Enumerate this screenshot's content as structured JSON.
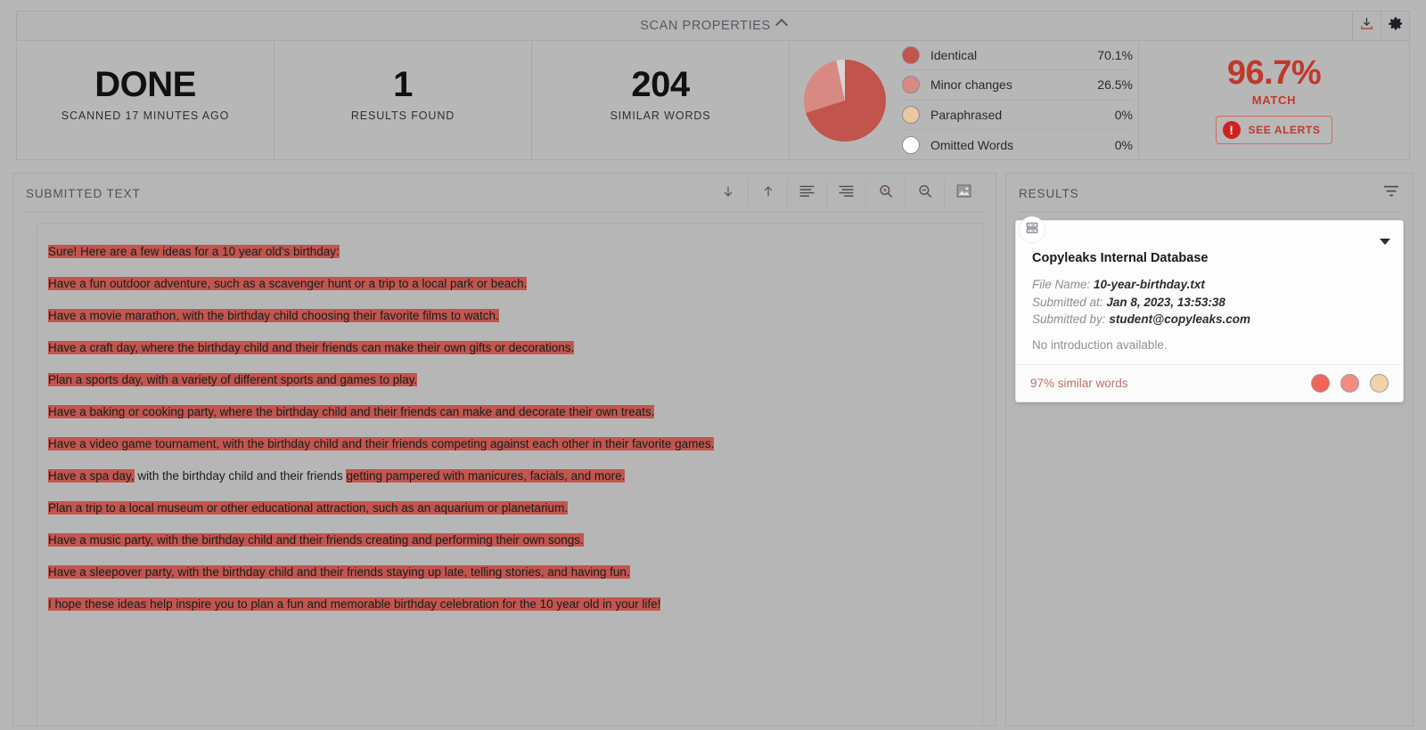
{
  "topbar": {
    "title": "SCAN PROPERTIES",
    "chevron_icon": "chevron-up-icon",
    "download_icon": "download-icon",
    "settings_icon": "gear-icon"
  },
  "stats": [
    {
      "value": "DONE",
      "label": "SCANNED 17 MINUTES AGO"
    },
    {
      "value": "1",
      "label": "RESULTS FOUND"
    },
    {
      "value": "204",
      "label": "SIMILAR WORDS"
    }
  ],
  "match": {
    "percent": "96.7%",
    "label": "MATCH",
    "alerts_button": "SEE ALERTS",
    "alert_icon": "!",
    "color": "#c0392b"
  },
  "chart_data": {
    "type": "pie",
    "title": "",
    "labels": [
      "Identical",
      "Minor changes",
      "Paraphrased",
      "Omitted Words"
    ],
    "values": [
      70.1,
      26.5,
      0,
      0
    ],
    "value_labels": [
      "70.1%",
      "26.5%",
      "0%",
      "0%"
    ],
    "colors": [
      "#c1544c",
      "#d98983",
      "#e7c8a0",
      "#ffffff"
    ],
    "legend_position": "right",
    "grid": false
  },
  "submitted_panel": {
    "title": "SUBMITTED TEXT",
    "tools": [
      {
        "name": "scroll-down-icon",
        "glyph": "↓"
      },
      {
        "name": "scroll-up-icon",
        "glyph": "↑"
      },
      {
        "name": "align-left-icon",
        "glyph": "align-left"
      },
      {
        "name": "align-right-icon",
        "glyph": "align-right"
      },
      {
        "name": "zoom-in-icon",
        "glyph": "zoom-in"
      },
      {
        "name": "zoom-out-icon",
        "glyph": "zoom-out"
      },
      {
        "name": "image-view-icon",
        "glyph": "image"
      }
    ],
    "lines": [
      [
        {
          "t": "Sure! Here are a few ideas for a 10 year old's birthday:",
          "h": true
        }
      ],
      [
        {
          "t": "Have a fun outdoor adventure, such as a scavenger hunt or a trip to a local park or beach.",
          "h": true
        }
      ],
      [
        {
          "t": "Have a movie marathon, with the birthday child choosing their favorite films to watch.",
          "h": true
        }
      ],
      [
        {
          "t": "Have a craft day, where the birthday child and their friends can make their own gifts or decorations.",
          "h": true
        }
      ],
      [
        {
          "t": "Plan a sports day, with a variety of different sports and games to play.",
          "h": true
        }
      ],
      [
        {
          "t": "Have a baking or cooking party, where the birthday child and their friends can make and decorate their own treats.",
          "h": true
        }
      ],
      [
        {
          "t": "Have a video game tournament, with the birthday child and their friends competing against each other in their favorite games.",
          "h": true
        }
      ],
      [
        {
          "t": "Have a spa day,",
          "h": true
        },
        {
          "t": " with the birthday child and their friends ",
          "h": false
        },
        {
          "t": "getting pampered with manicures, facials, and more.",
          "h": true
        }
      ],
      [
        {
          "t": "Plan a trip to a local museum or other educational attraction, such as an aquarium or planetarium.",
          "h": true
        }
      ],
      [
        {
          "t": "Have a music party, with the birthday child and their friends creating and performing their own songs.",
          "h": true
        }
      ],
      [
        {
          "t": "Have a sleepover party, with the birthday child and their friends staying up late, telling stories, and having fun.",
          "h": true
        }
      ],
      [
        {
          "t": "I hope these ideas help inspire you to plan a fun and memorable birthday celebration for the 10 year old in your life!",
          "h": true
        }
      ]
    ],
    "highlight_color": "#c2564f"
  },
  "results_panel": {
    "title": "RESULTS",
    "filter_icon": "filter-icon",
    "card": {
      "source_icon": "database-icon",
      "caret_icon": "caret-down-icon",
      "title": "Copyleaks Internal Database",
      "file_name_label": "File Name:",
      "file_name_value": "10-year-birthday.txt",
      "submitted_at_label": "Submitted at:",
      "submitted_at_value": "Jan 8, 2023, 13:53:38",
      "submitted_by_label": "Submitted by:",
      "submitted_by_value": "student@copyleaks.com",
      "introduction": "No introduction available.",
      "similar_words": "97% similar words",
      "dot_colors": [
        "#f4635a",
        "#f58c84",
        "#f0d3a8"
      ]
    }
  }
}
